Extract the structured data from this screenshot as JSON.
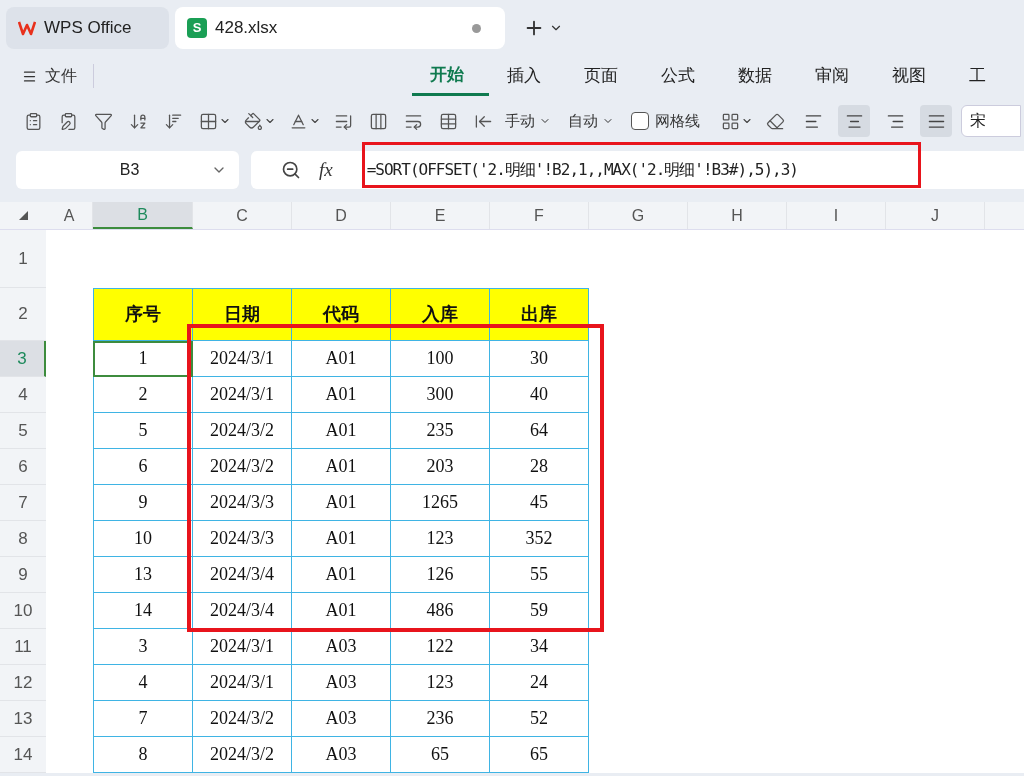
{
  "app_tabs": [
    {
      "label": "WPS Office",
      "kind": "home",
      "selected": false
    },
    {
      "label": "428.xlsx",
      "kind": "sheet",
      "badge": "S",
      "selected": true,
      "unsaved": true
    }
  ],
  "file_menu": "文件",
  "ribbon_tabs": [
    {
      "label": "开始",
      "selected": true
    },
    {
      "label": "插入",
      "selected": false
    },
    {
      "label": "页面",
      "selected": false
    },
    {
      "label": "公式",
      "selected": false
    },
    {
      "label": "数据",
      "selected": false
    },
    {
      "label": "审阅",
      "selected": false
    },
    {
      "label": "视图",
      "selected": false
    },
    {
      "label": "工",
      "selected": false
    }
  ],
  "toolbar": {
    "row_height_mode": "手动",
    "col_width_mode": "自动",
    "gridlines": {
      "label": "网格线",
      "checked": false
    },
    "align_buttons": [
      {
        "selected": false
      },
      {
        "selected": true
      },
      {
        "selected": false
      },
      {
        "selected": true
      }
    ],
    "font_name": "宋"
  },
  "formula_bar": {
    "name_box": "B3",
    "fx_label": "fx",
    "formula": "=SORT(OFFSET('2.明细'!B2,1,,MAX('2.明细'!B3#),5),3)"
  },
  "sheet": {
    "columns": [
      {
        "label": "A",
        "selected": false
      },
      {
        "label": "B",
        "selected": true
      },
      {
        "label": "C",
        "selected": false
      },
      {
        "label": "D",
        "selected": false
      },
      {
        "label": "E",
        "selected": false
      },
      {
        "label": "F",
        "selected": false
      },
      {
        "label": "G",
        "selected": false
      },
      {
        "label": "H",
        "selected": false
      },
      {
        "label": "I",
        "selected": false
      },
      {
        "label": "J",
        "selected": false
      }
    ],
    "rows": [
      {
        "number": "1",
        "kind": "blank",
        "selected": false,
        "cells": []
      },
      {
        "number": "2",
        "kind": "header",
        "selected": false,
        "cells": [
          "",
          "序号",
          "日期",
          "代码",
          "入库",
          "出库"
        ]
      },
      {
        "number": "3",
        "kind": "data",
        "selected": true,
        "cells": [
          "",
          "1",
          "2024/3/1",
          "A01",
          "100",
          "30"
        ]
      },
      {
        "number": "4",
        "kind": "data",
        "selected": false,
        "cells": [
          "",
          "2",
          "2024/3/1",
          "A01",
          "300",
          "40"
        ]
      },
      {
        "number": "5",
        "kind": "data",
        "selected": false,
        "cells": [
          "",
          "5",
          "2024/3/2",
          "A01",
          "235",
          "64"
        ]
      },
      {
        "number": "6",
        "kind": "data",
        "selected": false,
        "cells": [
          "",
          "6",
          "2024/3/2",
          "A01",
          "203",
          "28"
        ]
      },
      {
        "number": "7",
        "kind": "data",
        "selected": false,
        "cells": [
          "",
          "9",
          "2024/3/3",
          "A01",
          "1265",
          "45"
        ]
      },
      {
        "number": "8",
        "kind": "data",
        "selected": false,
        "cells": [
          "",
          "10",
          "2024/3/3",
          "A01",
          "123",
          "352"
        ]
      },
      {
        "number": "9",
        "kind": "data",
        "selected": false,
        "cells": [
          "",
          "13",
          "2024/3/4",
          "A01",
          "126",
          "55"
        ]
      },
      {
        "number": "10",
        "kind": "data",
        "selected": false,
        "cells": [
          "",
          "14",
          "2024/3/4",
          "A01",
          "486",
          "59"
        ]
      },
      {
        "number": "11",
        "kind": "data",
        "selected": false,
        "cells": [
          "",
          "3",
          "2024/3/1",
          "A03",
          "122",
          "34"
        ]
      },
      {
        "number": "12",
        "kind": "data",
        "selected": false,
        "cells": [
          "",
          "4",
          "2024/3/1",
          "A03",
          "123",
          "24"
        ]
      },
      {
        "number": "13",
        "kind": "data",
        "selected": false,
        "cells": [
          "",
          "7",
          "2024/3/2",
          "A03",
          "236",
          "52"
        ]
      },
      {
        "number": "14",
        "kind": "data",
        "selected": false,
        "cells": [
          "",
          "8",
          "2024/3/2",
          "A03",
          "65",
          "65"
        ]
      }
    ]
  }
}
